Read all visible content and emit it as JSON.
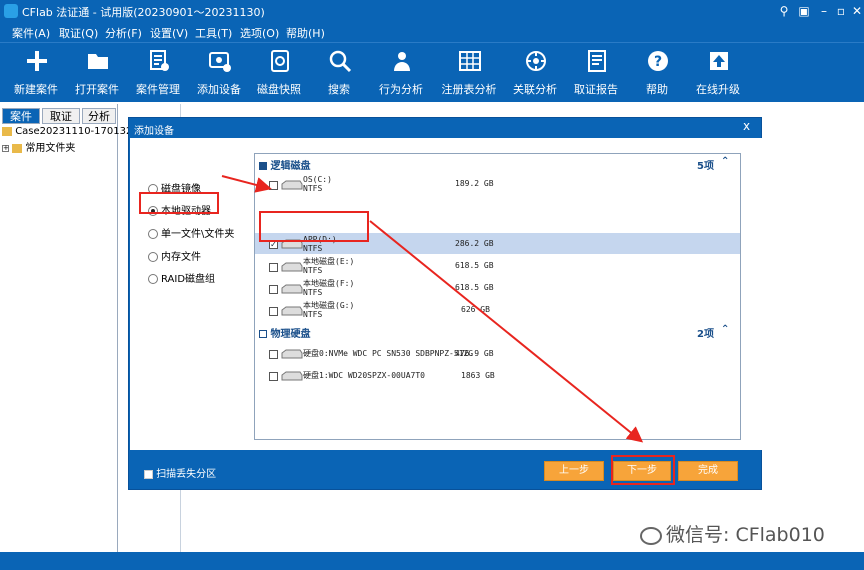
{
  "window": {
    "title": "CFlab 法证通 - 试用版(20230901～20231130)"
  },
  "menu": [
    "案件(A)",
    "取证(Q)",
    "分析(F)",
    "设置(V)",
    "工具(T)",
    "选项(O)",
    "帮助(H)"
  ],
  "toolbar": [
    {
      "label": "新建案件",
      "icon": "plus-icon"
    },
    {
      "label": "打开案件",
      "icon": "folder-icon"
    },
    {
      "label": "案件管理",
      "icon": "case-manage-icon"
    },
    {
      "label": "添加设备",
      "icon": "add-device-icon"
    },
    {
      "label": "磁盘快照",
      "icon": "disk-snapshot-icon"
    },
    {
      "label": "搜索",
      "icon": "search-icon"
    },
    {
      "label": "行为分析",
      "icon": "behavior-icon"
    },
    {
      "label": "注册表分析",
      "icon": "registry-icon"
    },
    {
      "label": "关联分析",
      "icon": "correlation-icon"
    },
    {
      "label": "取证报告",
      "icon": "report-icon"
    },
    {
      "label": "帮助",
      "icon": "help-icon"
    },
    {
      "label": "在线升级",
      "icon": "upgrade-icon"
    }
  ],
  "left_panel": {
    "tabs": [
      "案件",
      "取证",
      "分析"
    ],
    "tree": [
      "Case20231110-170132",
      "常用文件夹"
    ]
  },
  "dialog": {
    "title": "添加设备",
    "close": "x",
    "sources": [
      {
        "label": "磁盘镜像",
        "selected": false
      },
      {
        "label": "本地驱动器",
        "selected": true
      },
      {
        "label": "单一文件\\文件夹",
        "selected": false
      },
      {
        "label": "内存文件",
        "selected": false
      },
      {
        "label": "RAID磁盘组",
        "selected": false
      }
    ],
    "logical": {
      "title": "逻辑磁盘",
      "count": "5项",
      "items": [
        {
          "name": "OS(C:)",
          "fs": "NTFS",
          "size": "189.2 GB",
          "checked": false,
          "selected": false
        },
        {
          "name": "APP(D:)",
          "fs": "NTFS",
          "size": "286.2 GB",
          "checked": true,
          "selected": true
        },
        {
          "name": "本地磁盘(E:)",
          "fs": "NTFS",
          "size": "618.5 GB",
          "checked": false,
          "selected": false
        },
        {
          "name": "本地磁盘(F:)",
          "fs": "NTFS",
          "size": "618.5 GB",
          "checked": false,
          "selected": false
        },
        {
          "name": "本地磁盘(G:)",
          "fs": "NTFS",
          "size": "626 GB",
          "checked": false,
          "selected": false
        }
      ]
    },
    "physical": {
      "title": "物理硬盘",
      "count": "2项",
      "items": [
        {
          "name": "硬盘0:NVMe WDC PC SN530 SDBPNPZ-512G",
          "size": "476.9 GB",
          "checked": false
        },
        {
          "name": "硬盘1:WDC WD20SPZX-00UA7T0",
          "size": "1863 GB",
          "checked": false
        }
      ]
    },
    "scan_lost": "扫描丢失分区",
    "buttons": {
      "prev": "上一步",
      "next": "下一步",
      "finish": "完成"
    }
  },
  "watermark": "微信号: CFlab010"
}
